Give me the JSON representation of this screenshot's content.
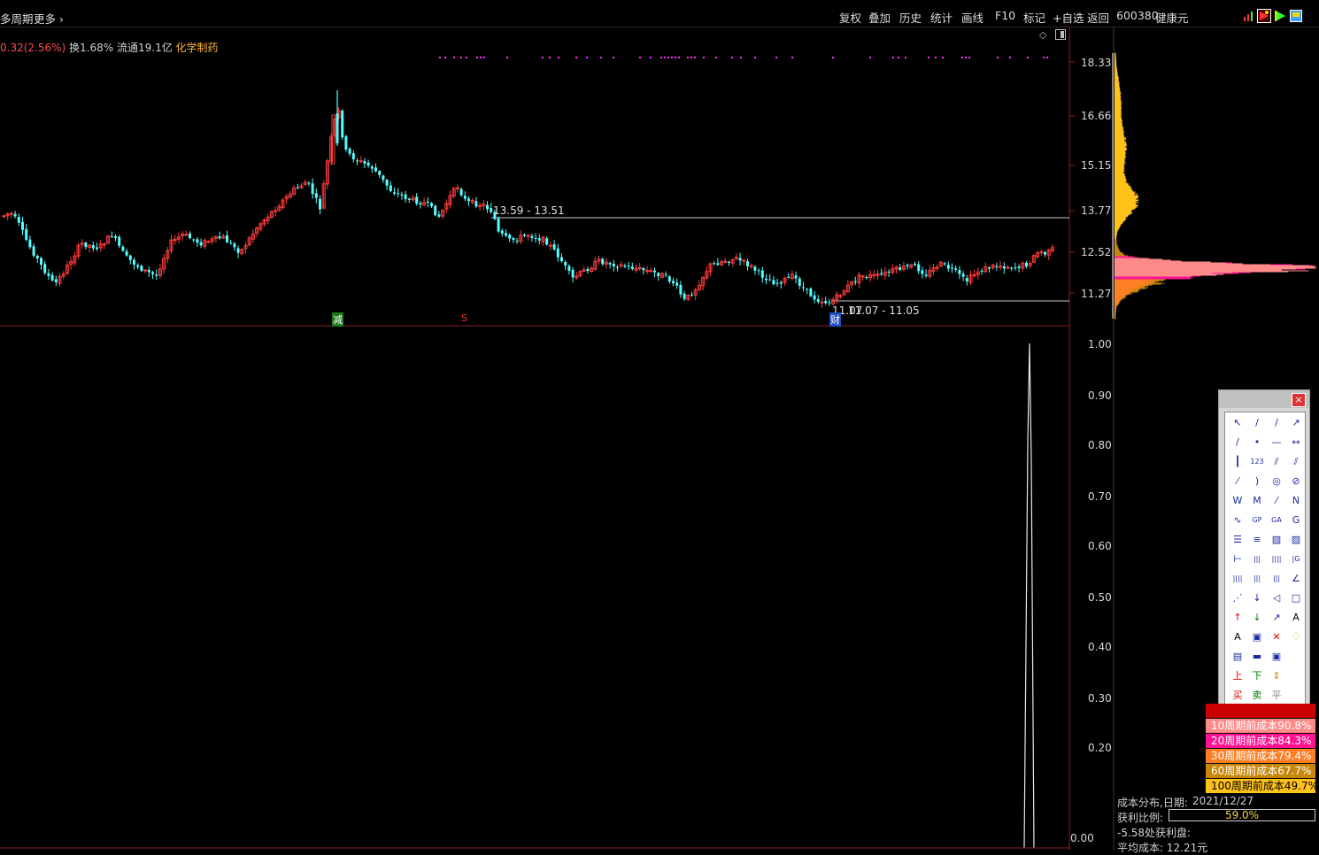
{
  "toolbar": {
    "period_label": "多周期",
    "more_label": "更多",
    "buttons": [
      "复权",
      "叠加",
      "历史",
      "统计",
      "画线",
      "F10",
      "标记",
      "+自选",
      "返回"
    ],
    "stock_code": "600380",
    "stock_name": "健康元"
  },
  "info_line": {
    "change": "0.32(2.56%)",
    "turnover": "换1.68%",
    "float_cap": "流通19.1亿",
    "sector": "化学制药"
  },
  "price_axis": [
    "18.33",
    "16.66",
    "15.15",
    "13.77",
    "12.52",
    "11.27"
  ],
  "indicator_axis": [
    "1.00",
    "0.90",
    "0.80",
    "0.70",
    "0.60",
    "0.50",
    "0.40",
    "0.30",
    "0.20",
    "0.00"
  ],
  "annotations": {
    "upper_line": "13.59 - 13.51",
    "lower_line": "11.07 - 11.05",
    "lower_line_overlap": "11.07",
    "mark_jian": "减",
    "mark_s": "S",
    "mark_cai": "财"
  },
  "cost_rows": [
    {
      "label": "10周期前成本90.8%",
      "bg": "#ff8a8a",
      "fg": "#ffffff"
    },
    {
      "label": "20周期前成本84.3%",
      "bg": "#ff1493",
      "fg": "#ffffff"
    },
    {
      "label": "30周期前成本79.4%",
      "bg": "#ff7f27",
      "fg": "#ffffff"
    },
    {
      "label": "60周期前成本67.7%",
      "bg": "#c8860a",
      "fg": "#ffffff"
    },
    {
      "label": "100周期前成本49.7%",
      "bg": "#ffc21a",
      "fg": "#000000"
    }
  ],
  "cost_info": {
    "date_label": "成本分布,日期:",
    "date": "2021/12/27",
    "profit_label": "获利比例:",
    "profit_value": "59.0%",
    "profit_ratio": 0.59,
    "profit_at": "-5.58处获利盘:",
    "avg_cost": "平均成本: 12.21元"
  },
  "colors": {
    "up": "#ff3c3c",
    "down": "#54ffff",
    "background": "#000000"
  }
}
